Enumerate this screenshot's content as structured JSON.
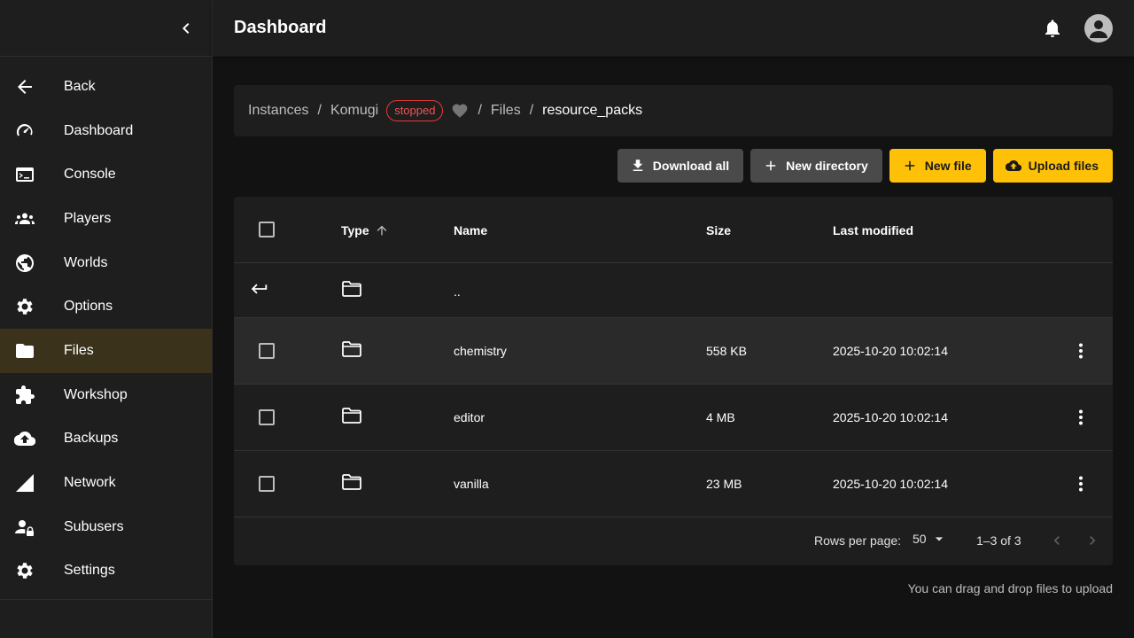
{
  "colors": {
    "accent": "#ffc107",
    "active_nav_bg": "#3a321a",
    "stopped": "#ef5350"
  },
  "sidebar": {
    "items": [
      {
        "label": "Back",
        "icon": "arrow-left-icon"
      },
      {
        "label": "Dashboard",
        "icon": "speedometer-icon"
      },
      {
        "label": "Console",
        "icon": "terminal-icon"
      },
      {
        "label": "Players",
        "icon": "group-icon"
      },
      {
        "label": "Worlds",
        "icon": "globe-icon"
      },
      {
        "label": "Options",
        "icon": "gear-icon"
      },
      {
        "label": "Files",
        "icon": "folder-icon",
        "active": true
      },
      {
        "label": "Workshop",
        "icon": "puzzle-icon"
      },
      {
        "label": "Backups",
        "icon": "cloud-upload-icon"
      },
      {
        "label": "Network",
        "icon": "signal-icon"
      },
      {
        "label": "Subusers",
        "icon": "person-lock-icon"
      },
      {
        "label": "Settings",
        "icon": "gear-icon"
      }
    ]
  },
  "header": {
    "title": "Dashboard"
  },
  "breadcrumb": {
    "instances": "Instances",
    "server": "Komugi",
    "status": "stopped",
    "files": "Files",
    "current": "resource_packs",
    "sep": "/"
  },
  "toolbar": {
    "download_all": "Download all",
    "new_directory": "New directory",
    "new_file": "New file",
    "upload_files": "Upload files"
  },
  "table": {
    "headers": {
      "type": "Type",
      "name": "Name",
      "size": "Size",
      "modified": "Last modified"
    },
    "parent_name": "..",
    "rows": [
      {
        "name": "chemistry",
        "size": "558 KB",
        "modified": "2025-10-20 10:02:14"
      },
      {
        "name": "editor",
        "size": "4 MB",
        "modified": "2025-10-20 10:02:14"
      },
      {
        "name": "vanilla",
        "size": "23 MB",
        "modified": "2025-10-20 10:02:14"
      }
    ],
    "footer": {
      "rows_per_page_label": "Rows per page:",
      "rows_per_page": "50",
      "range": "1–3 of 3"
    }
  },
  "hint": "You can drag and drop files to upload"
}
